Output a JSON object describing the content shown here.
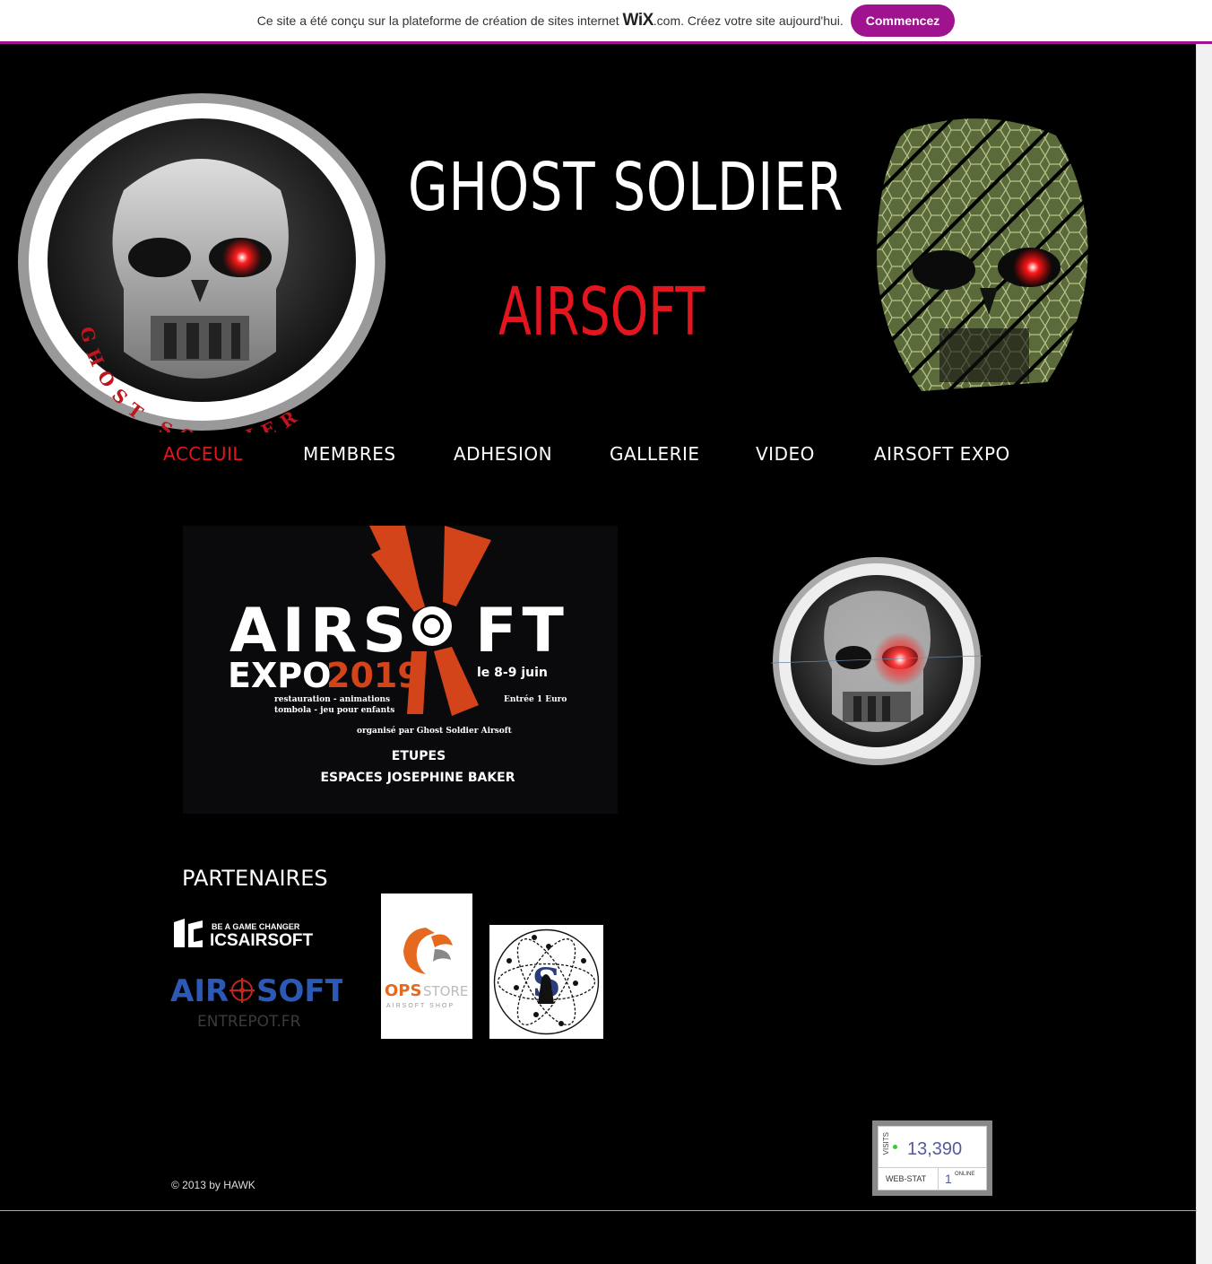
{
  "wix_banner": {
    "text_before": "Ce site a été conçu sur la plateforme de création de sites internet",
    "brand": "WiX",
    "brand_suffix": ".com.",
    "text_after": "Créez votre site aujourd'hui.",
    "button": "Commencez",
    "accent": "#a0138e"
  },
  "header": {
    "title_line1": "GHOST SOLDIER",
    "title_line2": "AIRSOFT",
    "logo_ring_text": "GHOST SOLDIER"
  },
  "nav": {
    "items": [
      {
        "label": "ACCEUIL",
        "active": true
      },
      {
        "label": "MEMBRES",
        "active": false
      },
      {
        "label": "ADHESION",
        "active": false
      },
      {
        "label": "GALLERIE",
        "active": false
      },
      {
        "label": "VIDEO",
        "active": false
      },
      {
        "label": "AIRSOFT EXPO",
        "active": false
      }
    ]
  },
  "expo_poster": {
    "airsoft_a": "AIRS",
    "airsoft_b": "FT",
    "expo": "EXPO",
    "year": "2019",
    "dates": "le 8-9 juin",
    "features_1": "restauration - animations",
    "features_2": "tombola - jeu pour enfants",
    "entry": "Entrée 1 Euro",
    "organizer": "organisé par Ghost Soldier Airsoft",
    "city": "ETUPES",
    "venue": "ESPACES JOSEPHINE BAKER"
  },
  "partners": {
    "heading": "PARTENAIRES",
    "ics_tagline": "BE A GAME CHANGER",
    "ics_name": "ICSAIRSOFT",
    "entrepot_a": "AIR",
    "entrepot_b": "SOFT",
    "entrepot_sub": "ENTREPOT.FR",
    "ops_a": "OPS",
    "ops_b": "STORE",
    "ops_sub": "AIRSOFT SHOP",
    "atom_letter": "S"
  },
  "footer": {
    "copyright": "© 2013 by  HAWK"
  },
  "counter": {
    "label": "VISITS",
    "visits": "13,390",
    "brand": "WEB-STAT",
    "online": "1",
    "online_label": "ONLINE"
  },
  "colors": {
    "background": "#000000",
    "accent_red": "#e3151e",
    "nav_text": "#ffffff"
  }
}
